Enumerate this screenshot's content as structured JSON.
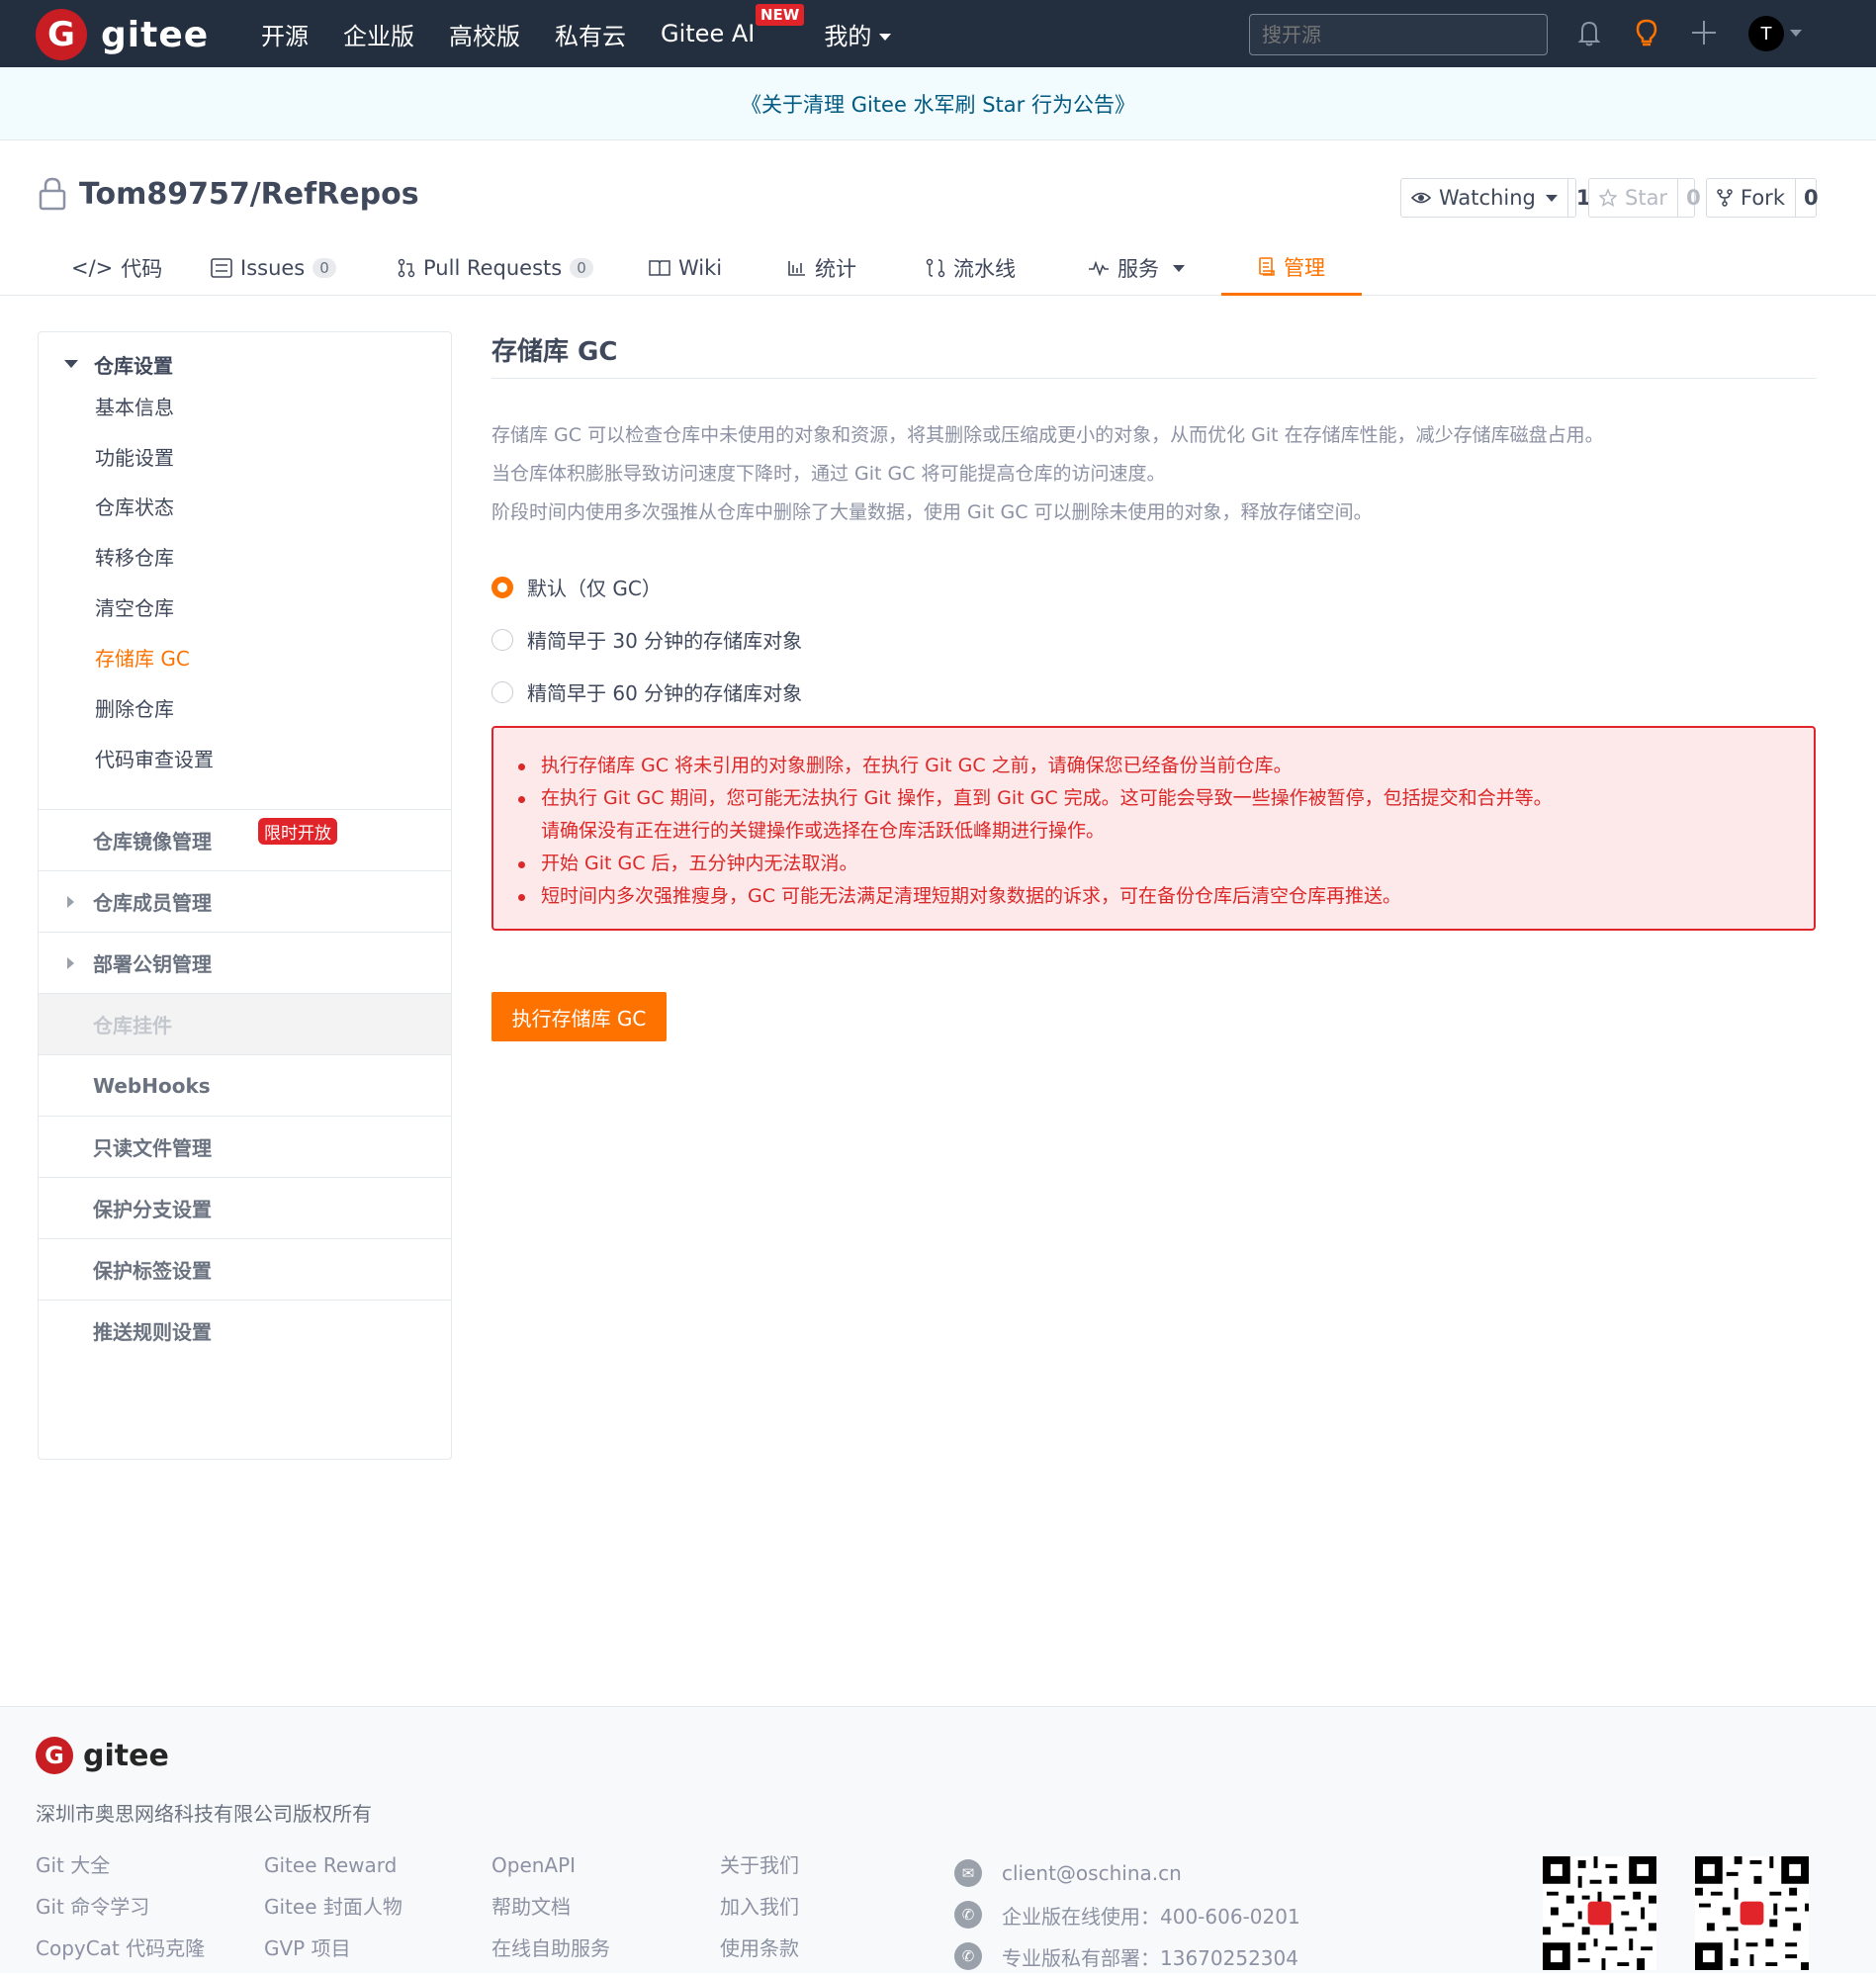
{
  "header": {
    "logo_text": "gitee",
    "logo_letter": "G",
    "nav": [
      "开源",
      "企业版",
      "高校版",
      "私有云",
      "Gitee AI",
      "我的"
    ],
    "new_badge": "NEW",
    "search_placeholder": "搜开源",
    "avatar_letter": "T"
  },
  "announcement": "《关于清理 Gitee 水军刷 Star 行为公告》",
  "repo": {
    "name": "Tom89757/RefRepos",
    "watch_label": "Watching",
    "watch_count": "1",
    "star_label": "Star",
    "star_count": "0",
    "fork_label": "Fork",
    "fork_count": "0"
  },
  "tabs": [
    {
      "label": "代码"
    },
    {
      "label": "Issues",
      "count": "0"
    },
    {
      "label": "Pull Requests",
      "count": "0"
    },
    {
      "label": "Wiki"
    },
    {
      "label": "统计"
    },
    {
      "label": "流水线"
    },
    {
      "label": "服务"
    },
    {
      "label": "管理"
    }
  ],
  "sidebar": {
    "section_title": "仓库设置",
    "sub_items": [
      "基本信息",
      "功能设置",
      "仓库状态",
      "转移仓库",
      "清空仓库",
      "存储库 GC",
      "删除仓库",
      "代码审查设置"
    ],
    "mirror": "仓库镜像管理",
    "mirror_badge": "限时开放",
    "members": "仓库成员管理",
    "deploy_keys": "部署公钥管理",
    "plugins": "仓库挂件",
    "rows": [
      "WebHooks",
      "只读文件管理",
      "保护分支设置",
      "保护标签设置",
      "推送规则设置"
    ]
  },
  "main": {
    "title": "存储库 GC",
    "desc": [
      "存储库 GC 可以检查仓库中未使用的对象和资源，将其删除或压缩成更小的对象，从而优化 Git 在存储库性能，减少存储库磁盘占用。",
      "当仓库体积膨胀导致访问速度下降时，通过 Git GC 将可能提高仓库的访问速度。",
      "阶段时间内使用多次强推从仓库中删除了大量数据，使用 Git GC 可以删除未使用的对象，释放存储空间。"
    ],
    "options": [
      "默认（仅 GC）",
      "精简早于 30 分钟的存储库对象",
      "精简早于 60 分钟的存储库对象"
    ],
    "selected_option": 0,
    "warnings": [
      "执行存储库 GC 将未引用的对象删除，在执行 Git GC 之前，请确保您已经备份当前仓库。",
      "在执行 Git GC 期间，您可能无法执行 Git 操作，直到 Git GC 完成。这可能会导致一些操作被暂停，包括提交和合并等。",
      "请确保没有正在进行的关键操作或选择在仓库活跃低峰期进行操作。",
      "开始 Git GC 后，五分钟内无法取消。",
      "短时间内多次强推瘦身，GC 可能无法满足清理短期对象数据的诉求，可在备份仓库后清空仓库再推送。"
    ],
    "run_button": "执行存储库 GC"
  },
  "footer": {
    "logo_text": "gitee",
    "copyright": "深圳市奥思网络科技有限公司版权所有",
    "col1": [
      "Git 大全",
      "Git 命令学习",
      "CopyCat 代码克隆"
    ],
    "col2": [
      "Gitee Reward",
      "Gitee 封面人物",
      "GVP 项目"
    ],
    "col3": [
      "OpenAPI",
      "帮助文档",
      "在线自助服务"
    ],
    "col4": [
      "关于我们",
      "加入我们",
      "使用条款"
    ],
    "contact": [
      "client@oschina.cn",
      "企业版在线使用：400-606-0201",
      "专业版私有部署：13670252304"
    ]
  },
  "colors": {
    "accent": "#fe7300",
    "topbar": "#232f3e",
    "danger": "#db2828",
    "brand_red": "#c71d23"
  }
}
